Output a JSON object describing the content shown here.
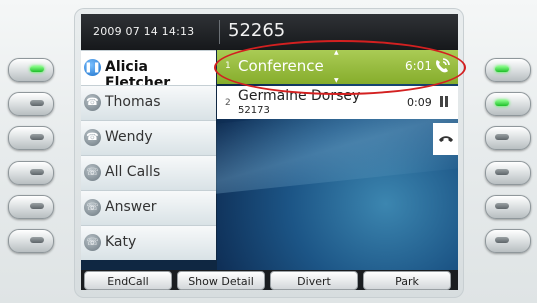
{
  "header": {
    "datetime": "2009 07 14 14:13",
    "extension": "52265"
  },
  "lines": [
    {
      "label": "Alicia Fletcher",
      "icon": "pause-icon",
      "active": true
    },
    {
      "label": "Thomas",
      "icon": "handset-icon"
    },
    {
      "label": "Wendy",
      "icon": "handset-icon"
    },
    {
      "label": "All Calls",
      "icon": "calls-icon"
    },
    {
      "label": "Answer",
      "icon": "answer-icon"
    },
    {
      "label": "Katy",
      "icon": "speed-dial-icon"
    }
  ],
  "calls": [
    {
      "index": "1",
      "name": "Conference",
      "timer": "6:01",
      "status_icon": "connected-icon"
    },
    {
      "index": "2",
      "name": "Germaine Dorsey",
      "number": "52173",
      "timer": "0:09",
      "status_icon": "hold-icon"
    }
  ],
  "softkeys": [
    "EndCall",
    "Show Detail",
    "Divert",
    "Park"
  ],
  "colors": {
    "active_call": "#93b83a",
    "line_led_on": "#2ecc40",
    "annotation": "#d32020",
    "header_bg": "#222528"
  }
}
